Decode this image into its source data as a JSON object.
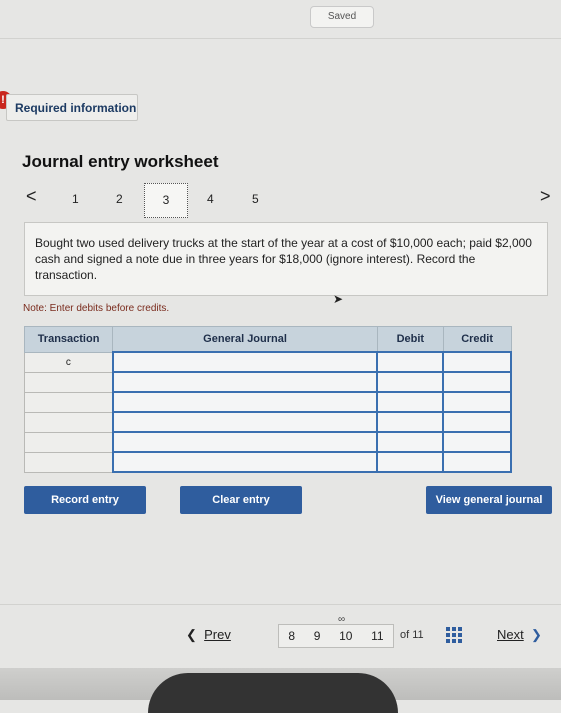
{
  "status": {
    "saved": "Saved"
  },
  "required": {
    "icon": "!",
    "label": "Required information"
  },
  "worksheet": {
    "title": "Journal entry worksheet",
    "pages": [
      "1",
      "2",
      "3",
      "4",
      "5"
    ],
    "active_page": "3",
    "prev_arrow": "<",
    "next_arrow": ">",
    "prompt": "Bought two used delivery trucks at the start of the year at a cost of $10,000 each; paid $2,000 cash and signed a note due in three years for $18,000 (ignore interest). Record the transaction.",
    "note": "Note: Enter debits before credits."
  },
  "table": {
    "headers": {
      "transaction": "Transaction",
      "journal": "General Journal",
      "debit": "Debit",
      "credit": "Credit"
    },
    "rows": [
      {
        "transaction": "c"
      },
      {
        "transaction": ""
      },
      {
        "transaction": ""
      },
      {
        "transaction": ""
      },
      {
        "transaction": ""
      },
      {
        "transaction": ""
      }
    ]
  },
  "buttons": {
    "record": "Record entry",
    "clear": "Clear entry",
    "view": "View general journal"
  },
  "footer": {
    "prev": "Prev",
    "pages": [
      "8",
      "9",
      "10",
      "11"
    ],
    "of_label": "of 11",
    "next": "Next"
  },
  "colors": {
    "accent": "#2f5d9e",
    "header_bg": "#c7d3dc",
    "required_icon": "#c9261e"
  }
}
